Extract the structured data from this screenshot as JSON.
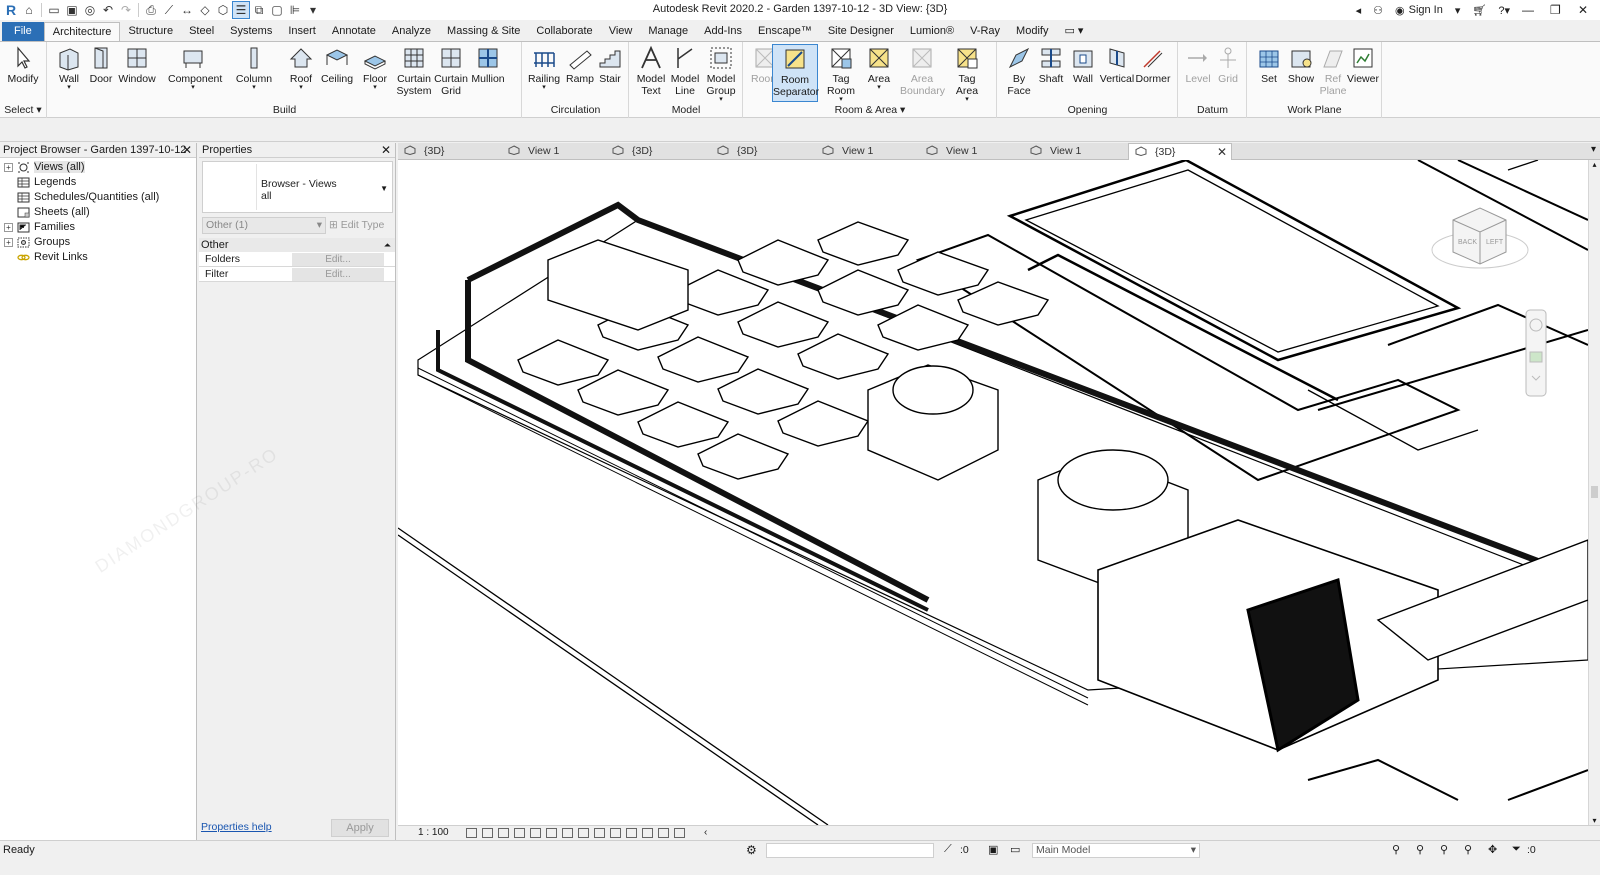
{
  "app": {
    "title": "Autodesk Revit 2020.2 - Garden 1397-10-12 - 3D View: {3D}",
    "sign_in": "Sign In"
  },
  "menu": [
    {
      "label": "File"
    },
    {
      "label": "Architecture"
    },
    {
      "label": "Structure"
    },
    {
      "label": "Steel"
    },
    {
      "label": "Systems"
    },
    {
      "label": "Insert"
    },
    {
      "label": "Annotate"
    },
    {
      "label": "Analyze"
    },
    {
      "label": "Massing & Site"
    },
    {
      "label": "Collaborate"
    },
    {
      "label": "View"
    },
    {
      "label": "Manage"
    },
    {
      "label": "Add-Ins"
    },
    {
      "label": "Enscape™"
    },
    {
      "label": "Site Designer"
    },
    {
      "label": "Lumion®"
    },
    {
      "label": "V-Ray"
    },
    {
      "label": "Modify"
    }
  ],
  "ribbon": {
    "panels": {
      "select": "Select",
      "build": "Build",
      "circulation": "Circulation",
      "model": "Model",
      "room_area": "Room & Area",
      "opening": "Opening",
      "datum": "Datum",
      "work_plane": "Work Plane"
    },
    "buttons": {
      "modify": "Modify",
      "wall": "Wall",
      "door": "Door",
      "window": "Window",
      "component": "Component",
      "column": "Column",
      "roof": "Roof",
      "ceiling": "Ceiling",
      "floor": "Floor",
      "curtain_system": "Curtain System",
      "curtain_grid": "Curtain Grid",
      "mullion": "Mullion",
      "railing": "Railing",
      "ramp": "Ramp",
      "stair": "Stair",
      "model_text": "Model Text",
      "model_line": "Model Line",
      "model_group": "Model Group",
      "room": "Room",
      "room_separator": "Room Separator",
      "tag_room": "Tag Room",
      "area": "Area",
      "area_boundary": "Area Boundary",
      "tag_area": "Tag Area",
      "by_face": "By Face",
      "shaft": "Shaft",
      "wall_opening": "Wall",
      "vertical": "Vertical",
      "dormer": "Dormer",
      "level": "Level",
      "grid": "Grid",
      "set": "Set",
      "show": "Show",
      "ref_plane": "Ref Plane",
      "viewer": "Viewer"
    }
  },
  "project_browser": {
    "title": "Project Browser - Garden 1397-10-12",
    "items": [
      {
        "label": "Views (all)"
      },
      {
        "label": "Legends"
      },
      {
        "label": "Schedules/Quantities (all)"
      },
      {
        "label": "Sheets (all)"
      },
      {
        "label": "Families"
      },
      {
        "label": "Groups"
      },
      {
        "label": "Revit Links"
      }
    ]
  },
  "properties": {
    "title": "Properties",
    "type_name": "Browser - Views",
    "type_sub": "all",
    "selector": "Other (1)",
    "edit_type": "Edit Type",
    "group": "Other",
    "rows": [
      {
        "name": "Folders",
        "value": "Edit..."
      },
      {
        "name": "Filter",
        "value": "Edit..."
      }
    ],
    "help": "Properties help",
    "apply": "Apply"
  },
  "view_tabs": [
    {
      "label": "{3D}"
    },
    {
      "label": "View 1"
    },
    {
      "label": "{3D}"
    },
    {
      "label": "{3D}"
    },
    {
      "label": "View 1"
    },
    {
      "label": "View 1"
    },
    {
      "label": "View 1"
    },
    {
      "label": "{3D}"
    }
  ],
  "view_control": {
    "scale": "1 : 100"
  },
  "viewcube": {
    "face_back": "BACK",
    "face_left": "LEFT"
  },
  "status": {
    "text": "Ready",
    "selection_count": ":0",
    "workset": "Main Model",
    "filter_count": ":0"
  },
  "watermark": "DIAMONDGROUP-RO",
  "colors": {
    "file_tab": "#2b6fb6",
    "selected_tool": "#cfe3f7",
    "selected_border": "#3a86d0"
  }
}
